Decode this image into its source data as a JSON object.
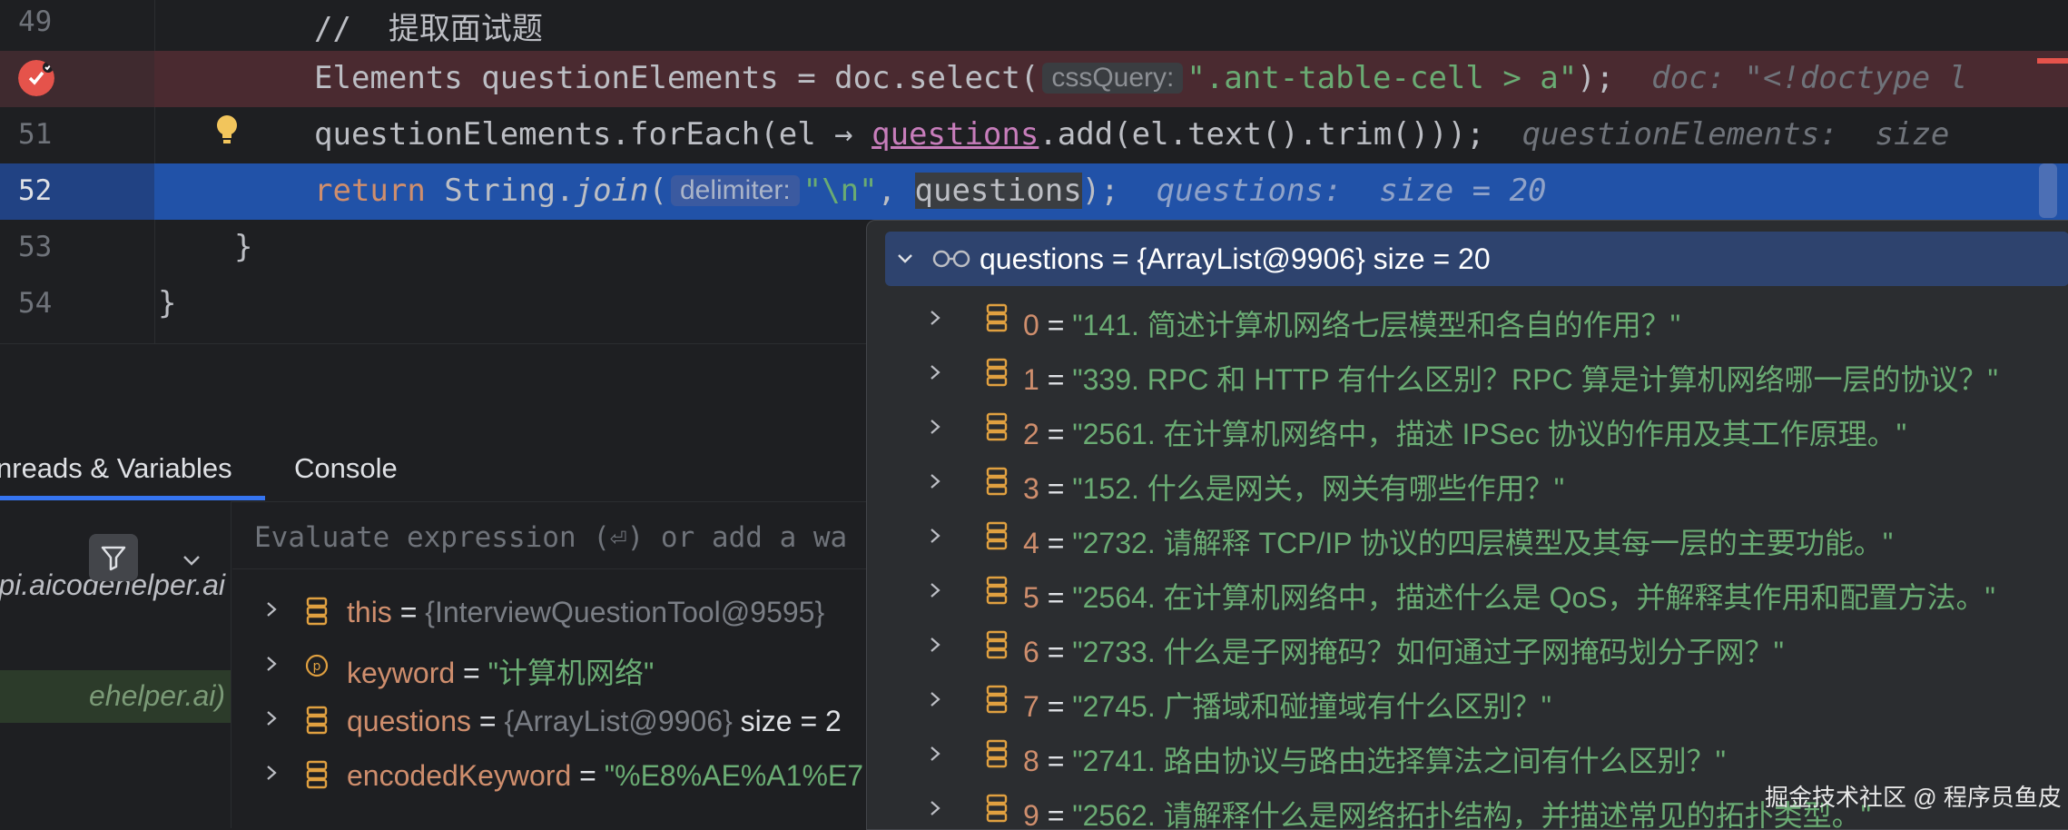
{
  "editor": {
    "lines": [
      {
        "num": "49",
        "comment": "//  提取面试题"
      },
      {
        "num": "",
        "pre": "Elements questionElements = doc.select(",
        "hint": "cssQuery:",
        "arg": "\".ant-table-cell > a\"",
        "post": ");",
        "inline": "doc: \"<!doctype l"
      },
      {
        "num": "51",
        "pre": "questionElements.forEach(el → ",
        "q": "questions",
        "post": ".add(el.text().trim()));",
        "inline": "questionElements:  size"
      },
      {
        "num": "52",
        "kw": "return",
        "pre2": " String.",
        "fn": "join",
        "paren": "(",
        "hint": "delimiter:",
        "arg": "\"\\n\"",
        "comma": ", ",
        "q": "questions",
        "post": ");",
        "inline": "questions:  size = 20"
      },
      {
        "num": "53",
        "code": "}"
      },
      {
        "num": "54",
        "code": "}"
      }
    ]
  },
  "debug": {
    "tabs": [
      "nreads & Variables",
      "Console"
    ],
    "evaluate_placeholder": "Evaluate expression (⏎) or add a wa",
    "frames": [
      "pi.aicodehelper.ai",
      "",
      "ehelper.ai)"
    ],
    "variables": [
      {
        "name": "this",
        "eq": " = ",
        "type": "{InterviewQuestionTool@9595}",
        "extra": "",
        "icon": "field-icon"
      },
      {
        "name": "keyword",
        "eq": " = ",
        "str": "\"计算机网络\"",
        "icon": "parameter-icon"
      },
      {
        "name": "questions",
        "eq": " = ",
        "type": "{ArrayList@9906}",
        "extra": "  size = 2",
        "icon": "field-icon"
      },
      {
        "name": "encodedKeyword",
        "eq": " = ",
        "str": "\"%E8%AE%A1%E7",
        "icon": "field-icon"
      }
    ]
  },
  "popup": {
    "header": "questions = {ArrayList@9906}  size = 20",
    "items": [
      {
        "i": "0",
        "v": "\"141. 简述计算机网络七层模型和各自的作用？\""
      },
      {
        "i": "1",
        "v": "\"339. RPC 和 HTTP 有什么区别？RPC 算是计算机网络哪一层的协议？\""
      },
      {
        "i": "2",
        "v": "\"2561. 在计算机网络中，描述 IPSec 协议的作用及其工作原理。\""
      },
      {
        "i": "3",
        "v": "\"152. 什么是网关，网关有哪些作用？\""
      },
      {
        "i": "4",
        "v": "\"2732. 请解释 TCP/IP 协议的四层模型及其每一层的主要功能。\""
      },
      {
        "i": "5",
        "v": "\"2564. 在计算机网络中，描述什么是 QoS，并解释其作用和配置方法。\""
      },
      {
        "i": "6",
        "v": "\"2733. 什么是子网掩码？如何通过子网掩码划分子网？\""
      },
      {
        "i": "7",
        "v": "\"2745. 广播域和碰撞域有什么区别？\""
      },
      {
        "i": "8",
        "v": "\"2741. 路由协议与路由选择算法之间有什么区别？\""
      },
      {
        "i": "9",
        "v": "\"2562. 请解释什么是网络拓扑结构，并描述常见的拓扑类型。\""
      }
    ]
  },
  "watermark": "掘金技术社区 @ 程序员鱼皮",
  "colors": {
    "accent": "#3574f0",
    "current_line": "#2152a8",
    "breakpoint": "#e5534b",
    "string": "#6aab73",
    "keyword": "#cf8e6d"
  }
}
